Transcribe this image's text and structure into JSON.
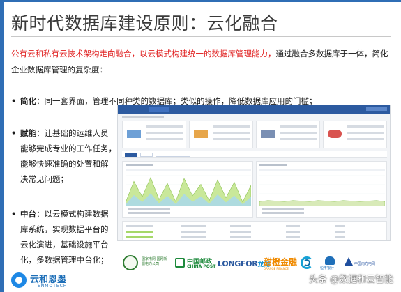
{
  "title": "新时代数据库建设原则：云化融合",
  "intro": {
    "red": "公有云和私有云技术架构走向融合，以云模式构建统一的数据库管理能力，",
    "rest": "通过融合多数据库于一体，简化企业数据库管理的复杂度："
  },
  "bullets": [
    {
      "dot": "•",
      "term": "简化",
      "sep": "：",
      "lines": [
        "同一套界面，管理不同种类的数据库；类似的操作，降低数据库应用的门槛；"
      ]
    },
    {
      "dot": "•",
      "term": "赋能",
      "sep": "：",
      "lines": [
        "让基础的运维人员",
        "能够完成专业的工作任务，",
        "能够快速准确的处置和解",
        "决常见问题；"
      ]
    },
    {
      "dot": "•",
      "term": "中台",
      "sep": "：",
      "lines": [
        "以云模式构建数据",
        "库系统，实现数据平台的",
        "云化演进，基础设施平台",
        "化，多数据管理中台化；"
      ]
    }
  ],
  "logos": {
    "nic": "国家电网 国网新疆电力公司",
    "post_cn": "中国邮政",
    "post_en": "CHINA POST",
    "longfor": "LONGFOR",
    "longfor_cn": "龙湖",
    "orange_cn": "甜橙金融",
    "orange_en": "ORANGE FINANCE",
    "hengfeng": "恒丰银行",
    "south": "中国南方电网"
  },
  "brand": {
    "cn": "云和恩墨",
    "en": "ENMOTECH"
  },
  "watermark": "头条 @数据和云智能",
  "colors": {
    "accent": "#2f6eb5",
    "red": "#e02020",
    "brand": "#1e6fb8"
  },
  "charts": [
    {
      "values": [
        8,
        52,
        20,
        60,
        14,
        48,
        10,
        58,
        22,
        46,
        12,
        55,
        18,
        50,
        9,
        44
      ]
    },
    {
      "values": [
        10,
        12,
        11,
        10,
        12,
        11,
        10,
        12,
        11,
        10,
        12,
        11,
        10,
        11,
        12,
        10
      ]
    }
  ]
}
